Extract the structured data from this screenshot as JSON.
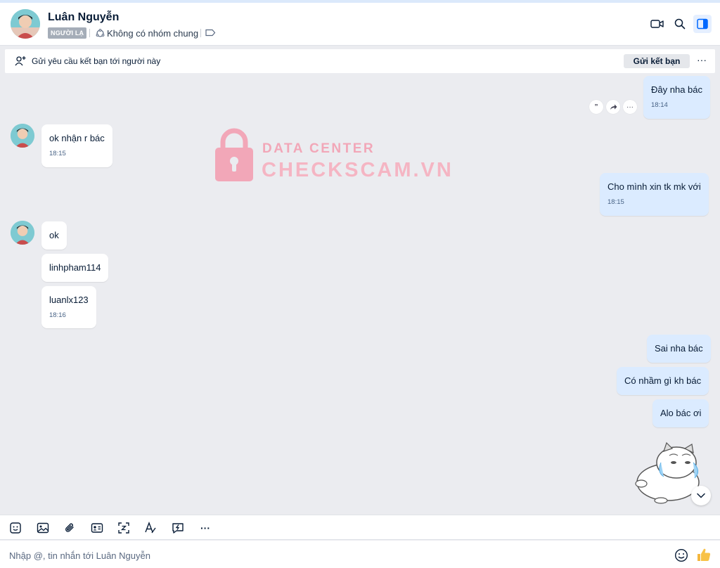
{
  "header": {
    "name": "Luân Nguyễn",
    "stranger_badge": "NGƯỜI LẠ",
    "common_groups": "Không có nhóm chung"
  },
  "friend_bar": {
    "text": "Gửi yêu cầu kết bạn tới người này",
    "button": "Gửi kết bạn",
    "more": "···"
  },
  "messages": [
    {
      "dir": "out",
      "text": "Đây nha bác",
      "time": "18:14"
    },
    {
      "dir": "in",
      "text": "ok nhận r bác",
      "time": "18:15"
    },
    {
      "dir": "out",
      "text": "Cho mình xin tk mk với",
      "time": "18:15"
    },
    {
      "dir": "in",
      "text": "ok"
    },
    {
      "dir": "in",
      "text": "linhpham114"
    },
    {
      "dir": "in",
      "text": "luanlx123",
      "time": "18:16"
    },
    {
      "dir": "out",
      "text": "Sai nha bác"
    },
    {
      "dir": "out",
      "text": "Có nhầm gì kh bác"
    },
    {
      "dir": "out",
      "text": "Alo bác ơi"
    }
  ],
  "watermark": {
    "line1": "DATA CENTER",
    "line2": "CHECKSCAM.VN"
  },
  "composer": {
    "placeholder": "Nhập @, tin nhắn tới Luân Nguyễn"
  },
  "toolbar": {
    "more": "···"
  },
  "colors": {
    "outgoing_bubble": "#dbebff",
    "incoming_bubble": "#ffffff",
    "background": "#ebecf0",
    "accent": "#0068ff"
  }
}
